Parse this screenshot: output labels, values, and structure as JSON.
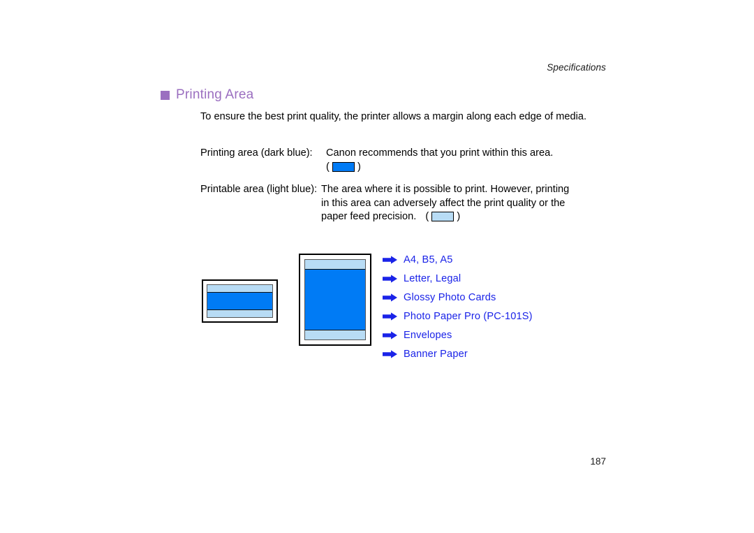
{
  "header": {
    "running_title": "Specifications"
  },
  "section": {
    "title": "Printing Area",
    "bullet_color": "#9B6FC0",
    "title_color": "#9B6FC0"
  },
  "body": {
    "intro": "To ensure the best print quality, the printer allows a margin along each edge of media.",
    "printing_area": {
      "label": "Printing area (dark blue):",
      "text": "Canon recommends that you print within this area.",
      "swatch_label": "dark blue swatch",
      "swatch_color": "#007BF5",
      "paren_open": "(",
      "paren_close": ")"
    },
    "printable_area": {
      "label": "Printable area (light blue):",
      "line1": "The area where it is possible to print.  However, printing",
      "line2": "in this area can adversely affect the print quality or the",
      "line3": "paper feed precision.",
      "swatch_label": "light blue swatch",
      "swatch_color": "#B8DCF5",
      "paren_open": "(",
      "paren_close": ")"
    }
  },
  "diagrams": {
    "landscape": {
      "name": "landscape-paper-diagram",
      "printable_color": "#B8DCF5",
      "printing_color": "#007BF5"
    },
    "portrait": {
      "name": "portrait-paper-diagram",
      "printable_color": "#B8DCF5",
      "printing_color": "#007BF5"
    }
  },
  "links": {
    "color": "#1A23E8",
    "items": [
      {
        "label": "A4, B5, A5",
        "icon": "arrow-right-icon"
      },
      {
        "label": "Letter, Legal",
        "icon": "arrow-right-icon"
      },
      {
        "label": "Glossy Photo Cards",
        "icon": "arrow-right-icon"
      },
      {
        "label": "Photo Paper Pro (PC-101S)",
        "icon": "arrow-right-icon"
      },
      {
        "label": "Envelopes",
        "icon": "arrow-right-icon"
      },
      {
        "label": "Banner Paper",
        "icon": "arrow-right-icon"
      }
    ]
  },
  "footer": {
    "page_number": "187"
  }
}
